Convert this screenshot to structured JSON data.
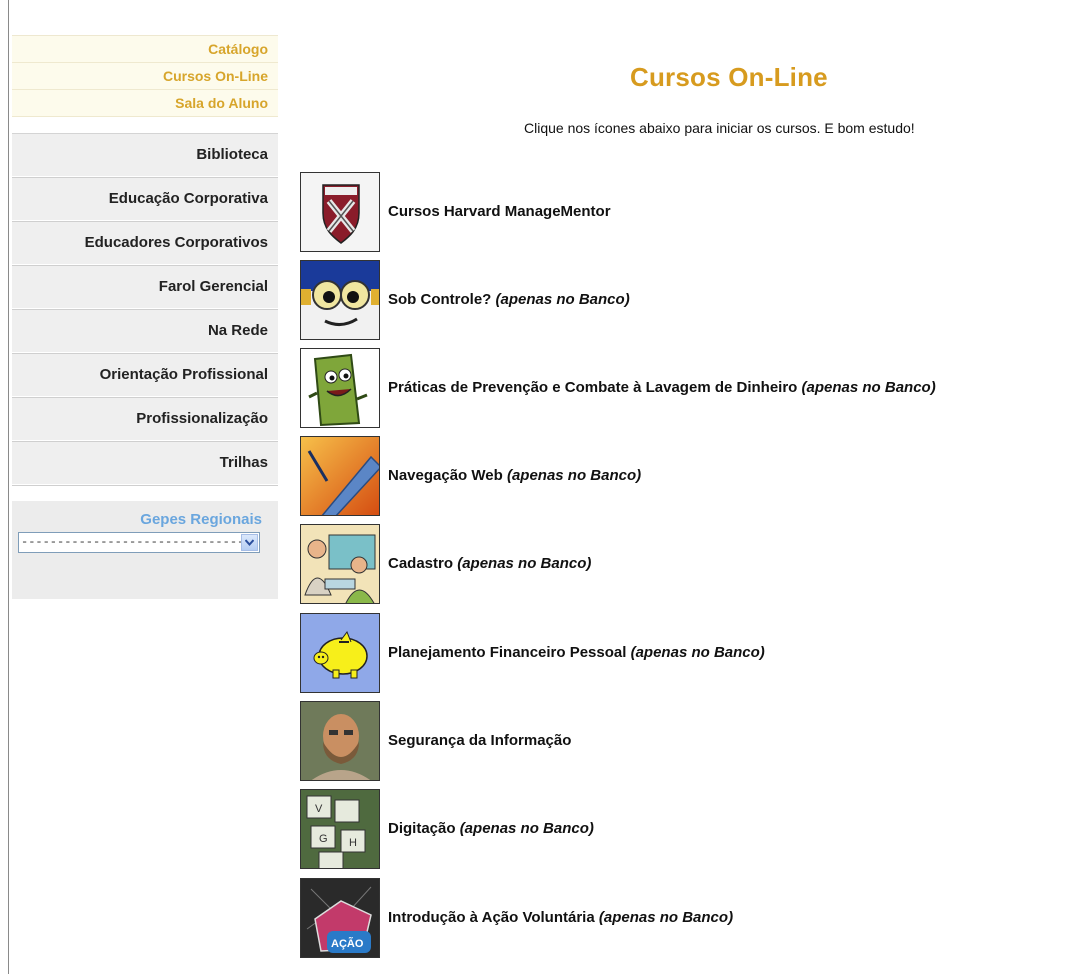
{
  "sidebar": {
    "top_links": [
      "Catálogo",
      "Cursos On-Line",
      "Sala do Aluno"
    ],
    "menu": [
      "Biblioteca",
      "Educação Corporativa",
      "Educadores Corporativos",
      "Farol Gerencial",
      "Na Rede",
      "Orientação Profissional",
      "Profissionalização",
      "Trilhas"
    ],
    "gepes": {
      "title": "Gepes Regionais",
      "selected": "--------------------------------"
    }
  },
  "main": {
    "title": "Cursos On-Line",
    "subtitle": "Clique nos ícones abaixo para iniciar os cursos. E bom estudo!",
    "courses": [
      {
        "name": "Cursos Harvard ManageMentor",
        "note": "",
        "icon": "harvard-shield-icon"
      },
      {
        "name": "Sob Controle?",
        "note": "(apenas no Banco)",
        "icon": "cartoon-eyes-icon"
      },
      {
        "name": "Práticas de Prevenção e Combate à Lavagem de Dinheiro",
        "note": "(apenas no Banco)",
        "icon": "money-character-icon"
      },
      {
        "name": "Navegação Web",
        "note": "(apenas no Banco)",
        "icon": "network-cable-icon"
      },
      {
        "name": "Cadastro",
        "note": "(apenas no Banco)",
        "icon": "office-people-icon"
      },
      {
        "name": "Planejamento Financeiro Pessoal",
        "note": "(apenas no Banco)",
        "icon": "piggy-bank-icon"
      },
      {
        "name": "Segurança da Informação",
        "note": "",
        "icon": "bearded-man-icon"
      },
      {
        "name": "Digitação",
        "note": "(apenas no Banco)",
        "icon": "keyboard-keys-icon"
      },
      {
        "name": "Introdução à Ação Voluntária",
        "note": "(apenas no Banco)",
        "icon": "acao-logo-icon",
        "icon_text": "AÇÃO"
      }
    ]
  }
}
